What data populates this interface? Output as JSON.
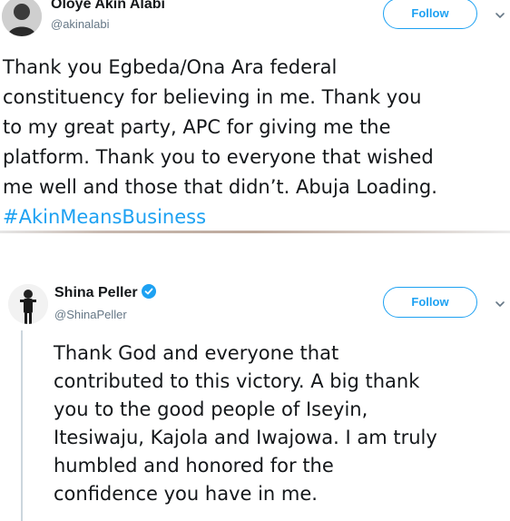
{
  "tweets": [
    {
      "name": "Oloye Akin Alabi",
      "handle": "@akinalabi",
      "follow_label": "Follow",
      "lines": [
        "Thank you Egbeda/Ona Ara federal",
        "constituency for believing in me. Thank you",
        "to my great party, APC for giving me the",
        "platform. Thank you to everyone that wished",
        "me well and those that didn’t. Abuja Loading."
      ],
      "hashtag": "#AkinMeansBusiness"
    },
    {
      "name": "Shina Peller",
      "handle": "@ShinaPeller",
      "follow_label": "Follow",
      "verified": true,
      "lines": [
        "Thank God and everyone that",
        "contributed to this victory. A big thank",
        "you to the good people of Iseyin,",
        "Itesiwaju, Kajola and Iwajowa. I am truly",
        "humbled and honored for the",
        "confidence you have in me."
      ]
    }
  ],
  "colors": {
    "accent": "#1da1f2",
    "secondary_text": "#657786",
    "text": "#14171a"
  },
  "icons": {
    "chevron": "chevron-down-icon",
    "verified": "verified-badge-icon"
  }
}
